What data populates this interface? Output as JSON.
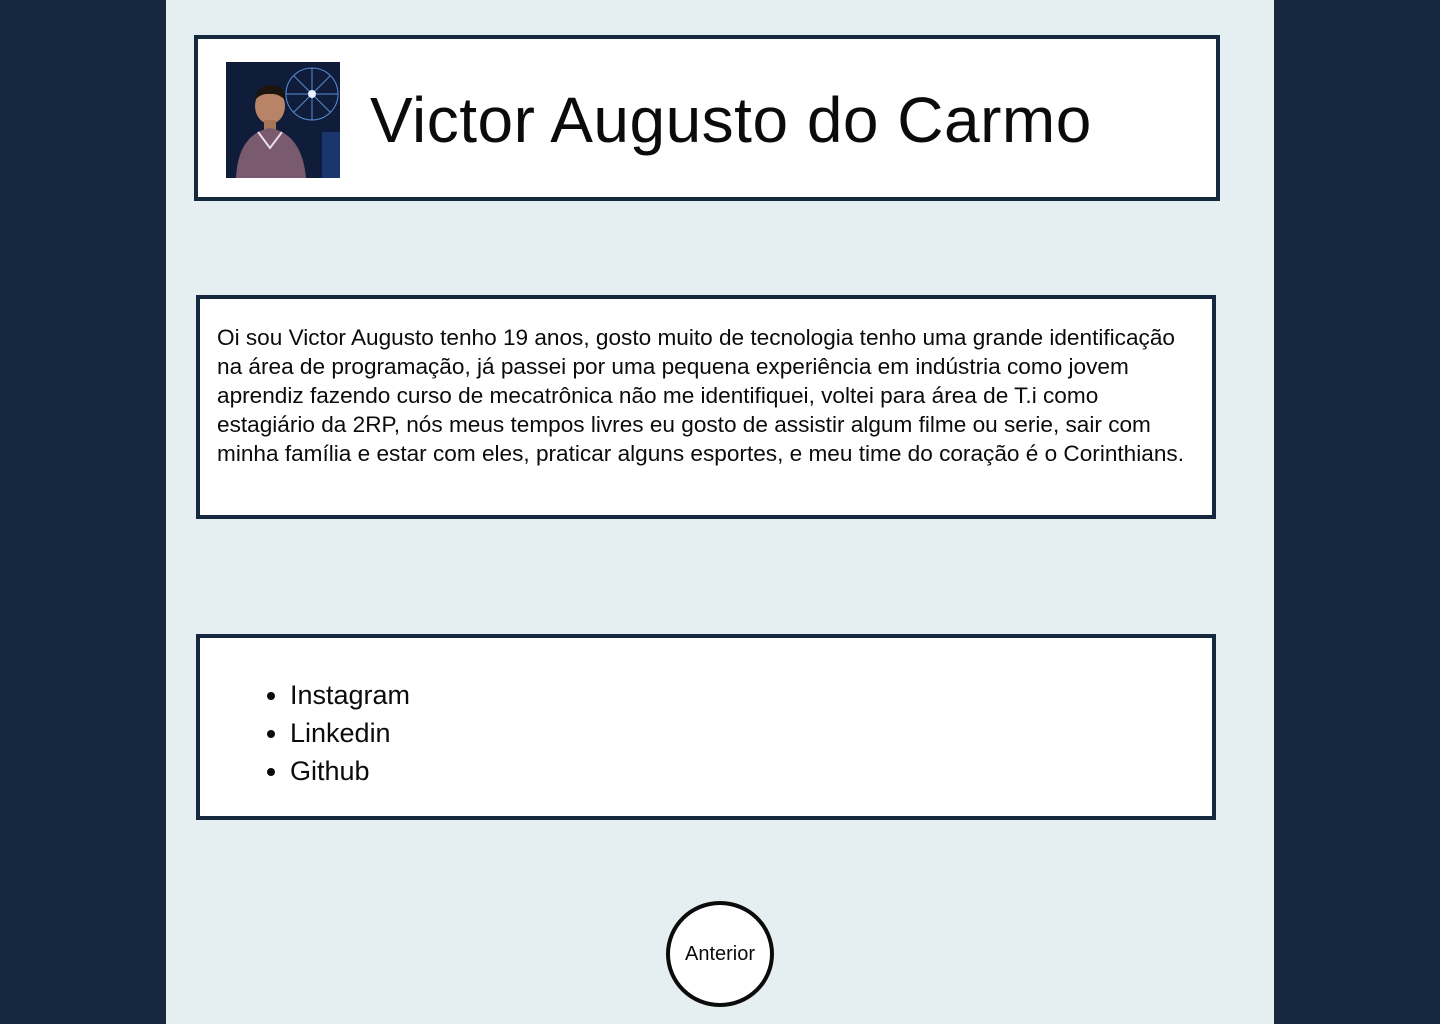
{
  "profile": {
    "name": "Victor Augusto do Carmo",
    "avatar_icon": "profile-photo"
  },
  "about": {
    "text": "Oi sou Victor Augusto tenho 19 anos, gosto muito de tecnologia tenho uma grande identificação na área de programação, já passei por uma pequena experiência em indústria como jovem aprendiz fazendo curso de mecatrônica não me identifiquei, voltei para área de T.i como estagiário da 2RP, nós meus tempos livres eu gosto de assistir algum filme ou serie, sair com minha família e estar com eles, praticar alguns esportes, e meu time do coração é o Corinthians."
  },
  "links": {
    "items": [
      {
        "label": "Instagram"
      },
      {
        "label": "Linkedin"
      },
      {
        "label": "Github"
      }
    ]
  },
  "navigation": {
    "previous_label": "Anterior"
  },
  "colors": {
    "page_background": "#15283d",
    "column_background": "#e5eff1",
    "card_background": "#ffffff",
    "card_border": "#15283d",
    "text": "#0b0b0b"
  }
}
